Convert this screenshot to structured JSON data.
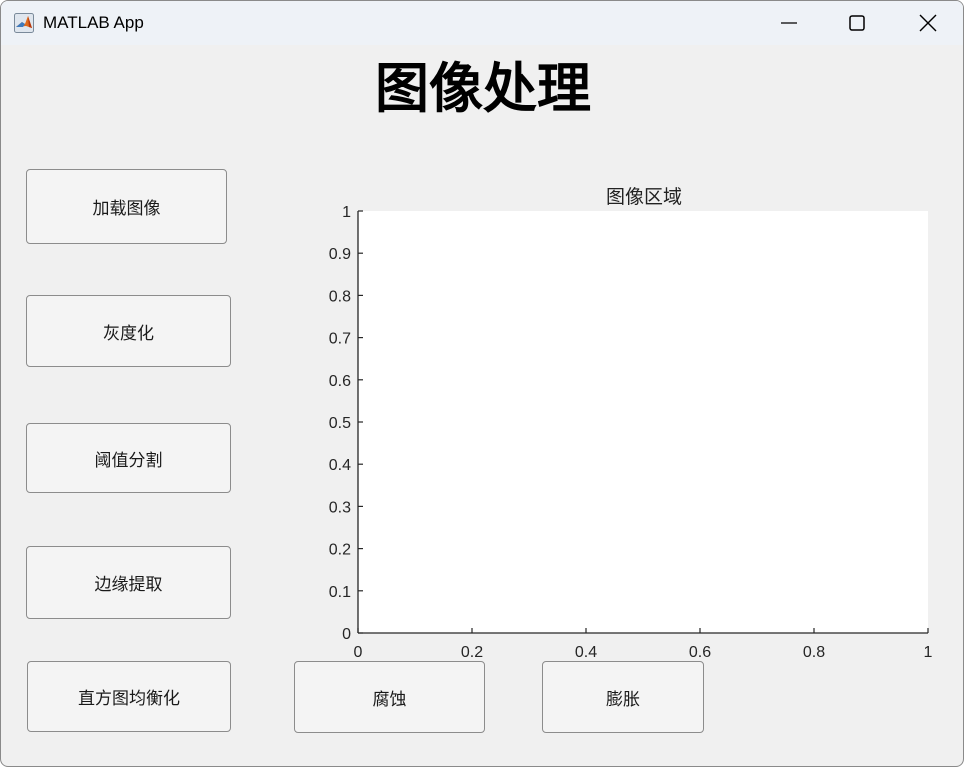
{
  "window": {
    "title": "MATLAB App",
    "app_icon": "matlab-membrane-icon",
    "controls": [
      "minimize-icon",
      "maximize-icon",
      "close-icon"
    ]
  },
  "heading": "图像处理",
  "buttons": {
    "load_image": "加载图像",
    "grayscale": "灰度化",
    "threshold_segmentation": "阈值分割",
    "edge_extraction": "边缘提取",
    "histogram_equalization": "直方图均衡化",
    "erosion": "腐蚀",
    "dilation": "膨胀"
  },
  "axes": {
    "title": "图像区域"
  },
  "chart_data": {
    "type": "scatter",
    "title": "图像区域",
    "xlabel": "",
    "ylabel": "",
    "xlim": [
      0,
      1
    ],
    "ylim": [
      0,
      1
    ],
    "xticks": [
      0,
      0.2,
      0.4,
      0.6,
      0.8,
      1
    ],
    "yticks": [
      0,
      0.1,
      0.2,
      0.3,
      0.4,
      0.5,
      0.6,
      0.7,
      0.8,
      0.9,
      1
    ],
    "xtick_labels": [
      "0",
      "0.2",
      "0.4",
      "0.6",
      "0.8",
      "1"
    ],
    "ytick_labels": [
      "0",
      "0.1",
      "0.2",
      "0.3",
      "0.4",
      "0.5",
      "0.6",
      "0.7",
      "0.8",
      "0.9",
      "1"
    ],
    "series": [],
    "grid": false
  }
}
